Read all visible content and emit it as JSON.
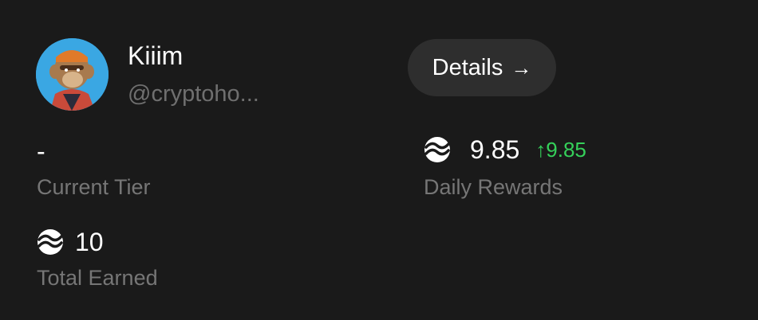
{
  "profile": {
    "name": "Kiiim",
    "handle": "@cryptoho..."
  },
  "details_button": {
    "label": "Details",
    "arrow": "→"
  },
  "current_tier": {
    "value": "-",
    "label": "Current Tier"
  },
  "daily_rewards": {
    "value": "9.85",
    "change_arrow": "↑",
    "change": "9.85",
    "label": "Daily Rewards",
    "change_color": "#35d05a"
  },
  "total_earned": {
    "value": "10",
    "label": "Total Earned"
  },
  "icons": {
    "token": "token-icon",
    "avatar": "avatar"
  }
}
